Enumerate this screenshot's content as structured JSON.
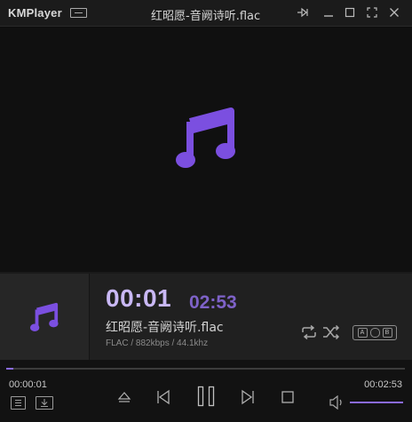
{
  "app": {
    "logo": "KMPlayer",
    "window_title": "红昭愿-音阙诗听.flac",
    "titlebar_icons": [
      "mini-mode-icon",
      "pin-icon",
      "minimize-icon",
      "maximize-icon",
      "fullscreen-icon",
      "close-icon"
    ]
  },
  "player": {
    "current_time_large": "00:01",
    "total_time_large": "02:53",
    "track_name": "红昭愿-音阙诗听.flac",
    "track_meta": "FLAC / 882kbps / 44.1khz",
    "ab_labels": [
      "A",
      "B"
    ],
    "progress_fraction": 0.006,
    "volume_fraction": 1.0
  },
  "controls": {
    "elapsed": "00:00:01",
    "duration": "00:02:53",
    "icons": [
      "playlist-icon",
      "download-icon",
      "eject-icon",
      "previous-icon",
      "pause-icon",
      "next-icon",
      "stop-icon",
      "volume-icon"
    ]
  },
  "colors": {
    "accent": "#8a6be6",
    "note_purple": "#7b4fe0",
    "time_current": "#c9b8f5",
    "time_total": "#7e62c8"
  }
}
